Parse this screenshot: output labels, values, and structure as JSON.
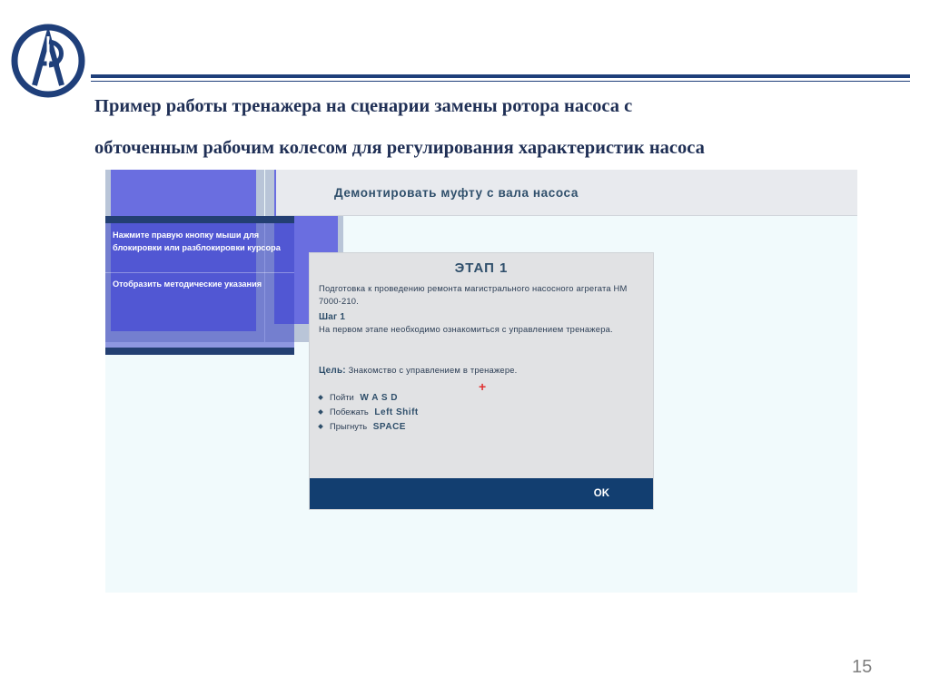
{
  "slide": {
    "title_lines": [
      "Пример работы тренажера на сценарии замены ротора насоса с",
      "обточенным рабочим колесом для регулирования характеристик насоса"
    ],
    "page_number": "15"
  },
  "screenshot": {
    "task": "Демонтировать муфту с вала насоса",
    "hint_panel": {
      "text": "Нажмите правую кнопку мыши для блокировки или разблокировки курсора",
      "link": "Отобразить методические указания"
    },
    "dialog": {
      "title": "ЭТАП 1",
      "intro": "Подготовка к проведению ремонта магистрального насосного агрегата НМ 7000-210.",
      "step_label": "Шаг 1",
      "step_text": "На первом этапе необходимо ознакомиться с управлением тренажера.",
      "goal_label": "Цель:",
      "goal_text": "Знакомство с управлением в тренажере.",
      "controls": [
        {
          "action": "Пойти",
          "key": "W A S D"
        },
        {
          "action": "Побежать",
          "key": "Left Shift"
        },
        {
          "action": "Прыгнуть",
          "key": "SPACE"
        }
      ],
      "crosshair": "+",
      "ok_label": "OK"
    }
  },
  "colors": {
    "brand_navy": "#1f3f7a",
    "ok_bar": "#123e70",
    "crosshair": "#e03030"
  }
}
